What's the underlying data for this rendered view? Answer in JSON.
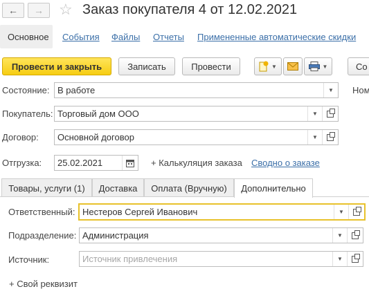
{
  "header": {
    "title": "Заказ покупателя 4 от 12.02.2021",
    "back_icon": "arrow-left-icon",
    "forward_icon": "arrow-right-icon",
    "favorite_icon": "star-icon"
  },
  "top_tabs": [
    {
      "label": "Основное",
      "active": true
    },
    {
      "label": "События"
    },
    {
      "label": "Файлы"
    },
    {
      "label": "Отчеты"
    },
    {
      "label": "Примененные автоматические скидки"
    }
  ],
  "toolbar": {
    "post_close": "Провести и закрыть",
    "save": "Записать",
    "post": "Провести",
    "more_cut": "Со"
  },
  "form": {
    "state_label": "Состояние:",
    "state_value": "В работе",
    "number_cut": "Ном",
    "buyer_label": "Покупатель:",
    "buyer_value": "Торговый дом ООО",
    "contract_label": "Договор:",
    "contract_value": "Основной договор",
    "shipment_label": "Отгрузка:",
    "shipment_value": "25.02.2021",
    "calc_link": "+ Калькуляция заказа",
    "summary_link": "Сводно о заказе"
  },
  "inner_tabs": [
    {
      "label": "Товары, услуги (1)"
    },
    {
      "label": "Доставка"
    },
    {
      "label": "Оплата (Вручную)"
    },
    {
      "label": "Дополнительно",
      "active": true
    }
  ],
  "extra": {
    "responsible_label": "Ответственный:",
    "responsible_value": "Нестеров Сергей Иванович",
    "department_label": "Подразделение:",
    "department_value": "Администрация",
    "source_label": "Источник:",
    "source_placeholder": "Источник привлечения",
    "add_prop": "+ Свой реквизит"
  },
  "colors": {
    "primary_button": "#f6cd12",
    "link": "#3b6fa8",
    "focus_border": "#e8c12a"
  }
}
